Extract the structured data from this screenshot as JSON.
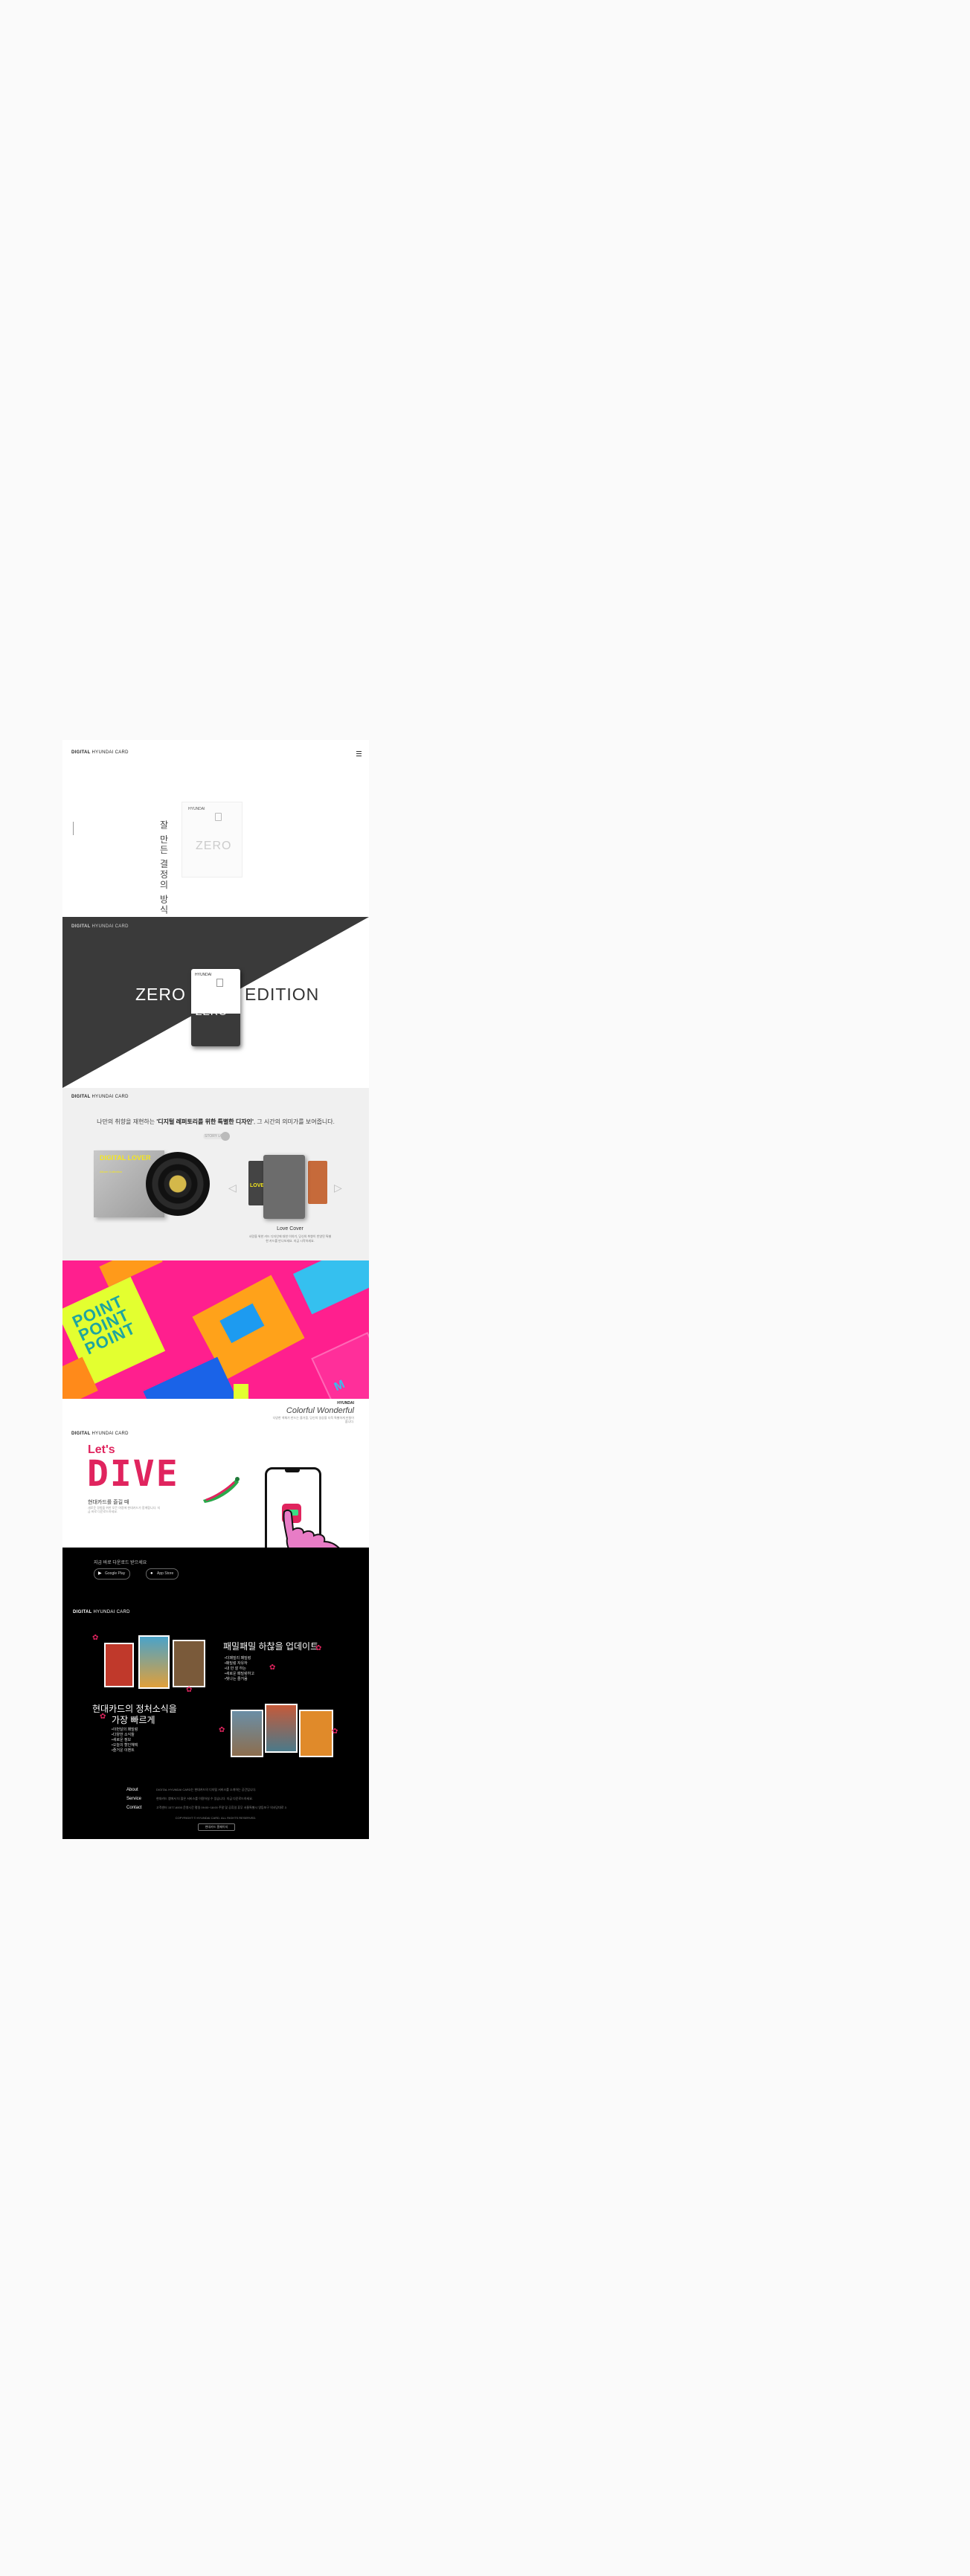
{
  "brand": {
    "logo_bold": "DIGITAL",
    "logo_thin": "HYUNDAI CARD"
  },
  "hero": {
    "vertical_text": "잘 만든 결정의 방식",
    "card_logo": "HYUNDAI",
    "card_word": "ZERO"
  },
  "zero": {
    "left_word": "ZERO",
    "right_word": "EDITION",
    "card_logo": "HYUNDAI",
    "card_word": "ZERO"
  },
  "love": {
    "headline_pre": "나만의 취향을 재현하는 ",
    "headline_bold": "'디지털 레퍼토리를 위한 특별한 디자인'",
    "headline_post": ", 그 시간의 의미가를 보여줍니다.",
    "toggle_label": "STORY LOVE",
    "album_title": "DIGITAL LOVER",
    "album_sub": "Album Collection",
    "card_love": "LOVE",
    "card_name": "Love Cover",
    "card_desc": "사랑을 위한 카드 디자인에 대한 이야기, 당신의 취향이 반영된 특별한 카드를 만나보세요. 지금 시작하세요."
  },
  "colorful": {
    "poster_text": "POINT POINT POINT",
    "logo": "HYUNDAI",
    "title": "Colorful Wonderful",
    "desc": "다양한 색채가 만드는 즐거움, 당신의 일상을 더욱 특별하게 만들어 줍니다."
  },
  "dive": {
    "lets": "Let's",
    "word": "DIVE",
    "sub": "현대카드를 즐길 때",
    "desc": "새로운 경험을 위한 모든 여정에 현대카드가 함께합니다. 지금 바로 다운로드하세요."
  },
  "app": {
    "download_label": "지금 바로 다운로드 받으세요",
    "google_label": "Google Play",
    "apple_label": "App Store",
    "update_title": "패밀패밀 하찮을 업데이트",
    "update_items": [
      "•더패밀리 패밀렁",
      "•패밀렁 자유하",
      "•내 만 잘 하는",
      "•새로운 패밀렁하고",
      "•빛나는 즐거움"
    ],
    "fast_title_1": "현대카드의 정처소식을",
    "fast_title_2": "가장 빠르게",
    "fast_items": [
      "•이번달의 패밀렁",
      "•다양한 소식들",
      "•새로운 정보",
      "•오늘의 할인혜택",
      "•즐거운 이벤트"
    ]
  },
  "footer": {
    "rows": [
      {
        "k": "About",
        "v": "DIGITAL HYUNDAI CARD는 현대카드의 디지털 서비스를 소개하는 공간입니다."
      },
      {
        "k": "Service",
        "v": "현대카드 앱에서 더 많은 서비스를 이용하실 수 있습니다. 지금 다운로드하세요."
      },
      {
        "k": "Contact",
        "v": "고객센터 1577-6000 운영시간 평일 09:00~18:00 주말 및 공휴일 휴무 서울특별시 영등포구 의사당대로 3"
      }
    ],
    "copyright": "COPYRIGHT © HYUNDAI CARD. ALL RIGHTS RESERVED.",
    "button": "현대카드 홈페이지"
  }
}
